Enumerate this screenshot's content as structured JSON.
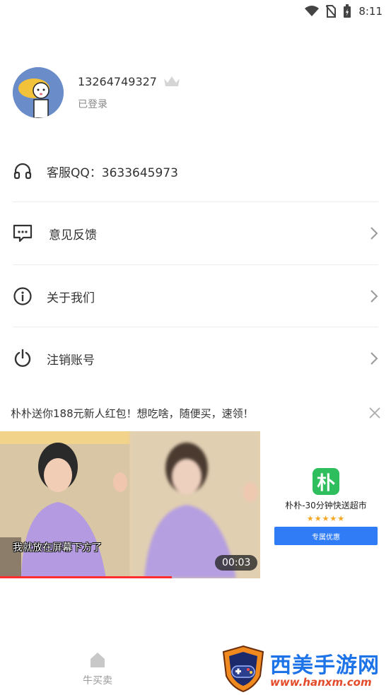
{
  "status_bar": {
    "time": "8:11"
  },
  "profile": {
    "phone": "13264749327",
    "login_state": "已登录"
  },
  "menu": {
    "customer_service": "客服QQ：3633645973",
    "feedback": "意见反馈",
    "about": "关于我们",
    "logout": "注销账号"
  },
  "ad": {
    "title": "朴朴送你188元新人红包！想吃啥，随便买，速领！",
    "video_subtitle": "我就放在屏幕下方了",
    "duration": "00:03",
    "progress": 0.66,
    "app_logo_text": "朴",
    "app_name": "朴朴-30分钟快送超市",
    "rating_stars": "★★★★★",
    "cta": "专属优惠"
  },
  "tabbar": {
    "tab1_label": "牛买卖"
  },
  "watermark": {
    "text": "西美手游网",
    "url": "www.hanxm.com"
  },
  "colors": {
    "accent": "#2f7cf6",
    "progress": "#ff2d2d",
    "app_green": "#2fbe5e"
  }
}
